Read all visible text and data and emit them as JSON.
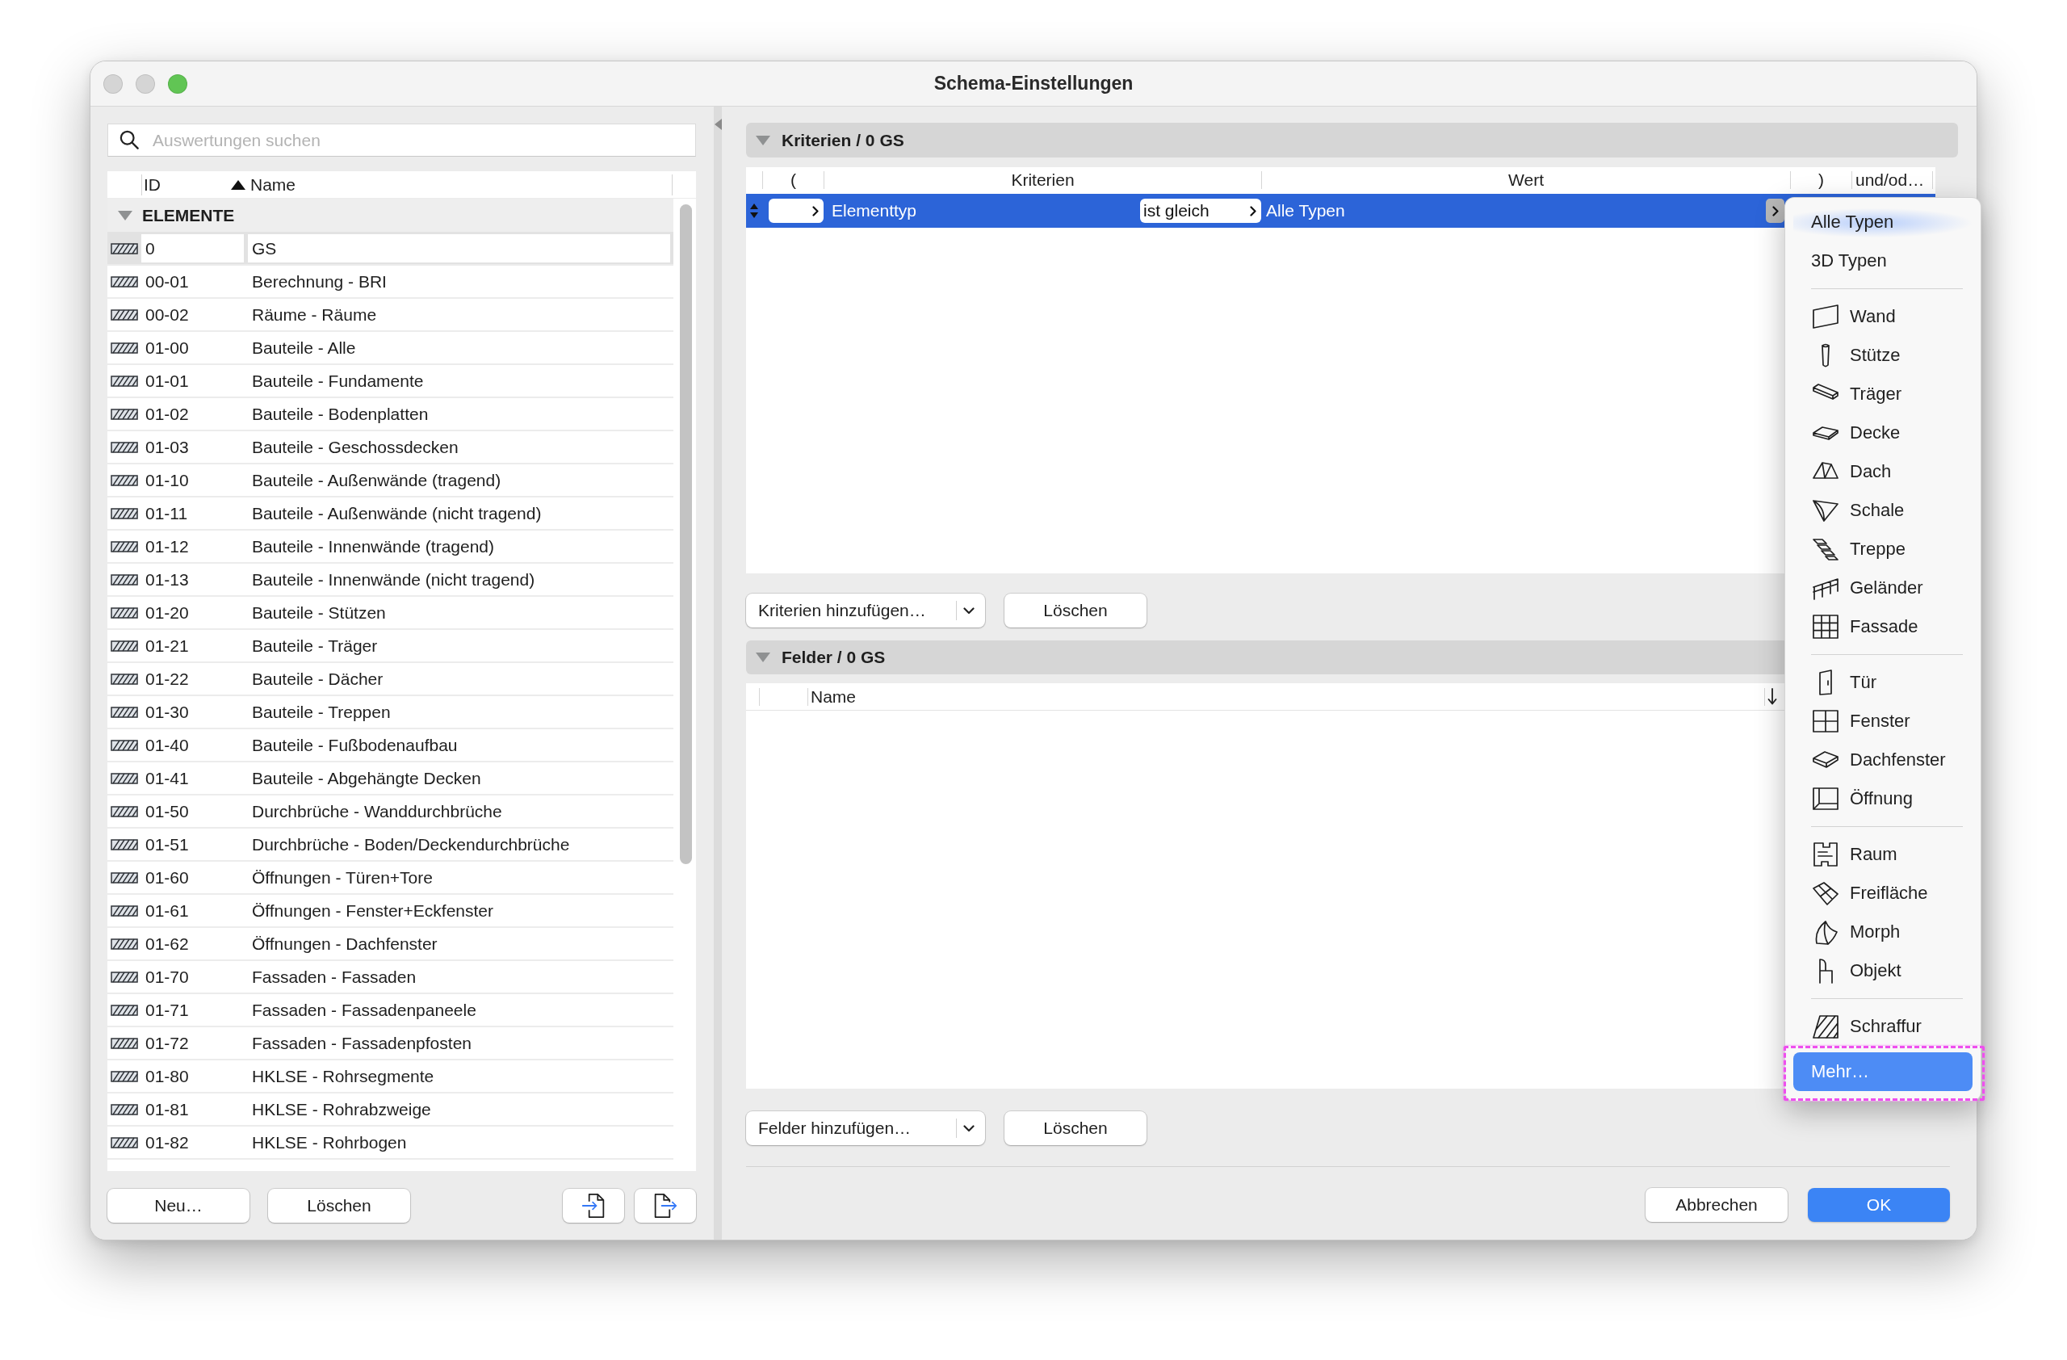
{
  "window": {
    "title": "Schema-Einstellungen",
    "controls": [
      {
        "kind": "close",
        "disabled": true
      },
      {
        "kind": "minimize",
        "disabled": true
      },
      {
        "kind": "zoom",
        "disabled": false
      }
    ]
  },
  "sidebar": {
    "search": {
      "placeholder": "Auswertungen suchen"
    },
    "columns": [
      {
        "label": "ID",
        "sorted": true
      },
      {
        "label": "Name",
        "sorted": false
      }
    ],
    "group": {
      "label": "ELEMENTE",
      "expanded": true
    },
    "rows": [
      {
        "id": "0",
        "name": "GS",
        "selected": true
      },
      {
        "id": "00-01",
        "name": "Berechnung - BRI",
        "selected": false
      },
      {
        "id": "00-02",
        "name": "Räume - Räume",
        "selected": false
      },
      {
        "id": "01-00",
        "name": "Bauteile - Alle",
        "selected": false
      },
      {
        "id": "01-01",
        "name": "Bauteile - Fundamente",
        "selected": false
      },
      {
        "id": "01-02",
        "name": "Bauteile - Bodenplatten",
        "selected": false
      },
      {
        "id": "01-03",
        "name": "Bauteile - Geschossdecken",
        "selected": false
      },
      {
        "id": "01-10",
        "name": "Bauteile - Außenwände (tragend)",
        "selected": false
      },
      {
        "id": "01-11",
        "name": "Bauteile - Außenwände (nicht tragend)",
        "selected": false
      },
      {
        "id": "01-12",
        "name": "Bauteile - Innenwände (tragend)",
        "selected": false
      },
      {
        "id": "01-13",
        "name": "Bauteile - Innenwände (nicht tragend)",
        "selected": false
      },
      {
        "id": "01-20",
        "name": "Bauteile - Stützen",
        "selected": false
      },
      {
        "id": "01-21",
        "name": "Bauteile - Träger",
        "selected": false
      },
      {
        "id": "01-22",
        "name": "Bauteile - Dächer",
        "selected": false
      },
      {
        "id": "01-30",
        "name": "Bauteile - Treppen",
        "selected": false
      },
      {
        "id": "01-40",
        "name": "Bauteile - Fußbodenaufbau",
        "selected": false
      },
      {
        "id": "01-41",
        "name": "Bauteile - Abgehängte Decken",
        "selected": false
      },
      {
        "id": "01-50",
        "name": "Durchbrüche - Wanddurchbrüche",
        "selected": false
      },
      {
        "id": "01-51",
        "name": "Durchbrüche - Boden/Deckendurchbrüche",
        "selected": false
      },
      {
        "id": "01-60",
        "name": "Öffnungen - Türen+Tore",
        "selected": false
      },
      {
        "id": "01-61",
        "name": "Öffnungen - Fenster+Eckfenster",
        "selected": false
      },
      {
        "id": "01-62",
        "name": "Öffnungen - Dachfenster",
        "selected": false
      },
      {
        "id": "01-70",
        "name": "Fassaden - Fassaden",
        "selected": false
      },
      {
        "id": "01-71",
        "name": "Fassaden - Fassadenpaneele",
        "selected": false
      },
      {
        "id": "01-72",
        "name": "Fassaden - Fassadenpfosten",
        "selected": false
      },
      {
        "id": "01-80",
        "name": "HKLSE - Rohrsegmente",
        "selected": false
      },
      {
        "id": "01-81",
        "name": "HKLSE - Rohrabzweige",
        "selected": false
      },
      {
        "id": "01-82",
        "name": "HKLSE - Rohrbogen",
        "selected": false
      }
    ],
    "buttons": [
      {
        "label": "Neu…"
      },
      {
        "label": "Löschen"
      }
    ]
  },
  "criteria": {
    "title": "Kriterien / 0 GS",
    "expanded": true,
    "columns": [
      "(",
      "Kriterien",
      "Wert",
      ")",
      "und/od…"
    ],
    "rows": [
      {
        "criterion": "Elementtyp",
        "operator": "ist gleich",
        "value": "Alle Typen",
        "selected": true
      }
    ],
    "add_button": "Kriterien hinzufügen…",
    "delete_button": "Löschen"
  },
  "fields": {
    "title": "Felder / 0 GS",
    "expanded": true,
    "columns": [
      "Name"
    ],
    "add_button": "Felder hinzufügen…",
    "delete_button": "Löschen"
  },
  "dialog_buttons": [
    {
      "label": "Abbrechen",
      "kind": "secondary"
    },
    {
      "label": "OK",
      "kind": "default"
    }
  ],
  "type_menu": {
    "sections": [
      {
        "items": [
          {
            "label": "Alle Typen",
            "kind": "plain",
            "selected": false,
            "current": true,
            "outlined": false
          },
          {
            "label": "3D Typen",
            "kind": "plain",
            "selected": false,
            "current": false,
            "outlined": false
          }
        ]
      },
      {
        "items": [
          {
            "label": "Wand",
            "kind": "icon",
            "selected": false,
            "current": false,
            "outlined": false
          },
          {
            "label": "Stütze",
            "kind": "icon",
            "selected": false,
            "current": false,
            "outlined": false
          },
          {
            "label": "Träger",
            "kind": "icon",
            "selected": false,
            "current": false,
            "outlined": false
          },
          {
            "label": "Decke",
            "kind": "icon",
            "selected": false,
            "current": false,
            "outlined": false
          },
          {
            "label": "Dach",
            "kind": "icon",
            "selected": false,
            "current": false,
            "outlined": false
          },
          {
            "label": "Schale",
            "kind": "icon",
            "selected": false,
            "current": false,
            "outlined": false
          },
          {
            "label": "Treppe",
            "kind": "icon",
            "selected": false,
            "current": false,
            "outlined": false
          },
          {
            "label": "Geländer",
            "kind": "icon",
            "selected": false,
            "current": false,
            "outlined": false
          },
          {
            "label": "Fassade",
            "kind": "icon",
            "selected": false,
            "current": false,
            "outlined": false
          }
        ]
      },
      {
        "items": [
          {
            "label": "Tür",
            "kind": "icon",
            "selected": false,
            "current": false,
            "outlined": false
          },
          {
            "label": "Fenster",
            "kind": "icon",
            "selected": false,
            "current": false,
            "outlined": false
          },
          {
            "label": "Dachfenster",
            "kind": "icon",
            "selected": false,
            "current": false,
            "outlined": false
          },
          {
            "label": "Öffnung",
            "kind": "icon",
            "selected": false,
            "current": false,
            "outlined": false
          }
        ]
      },
      {
        "items": [
          {
            "label": "Raum",
            "kind": "icon",
            "selected": false,
            "current": false,
            "outlined": false
          },
          {
            "label": "Freifläche",
            "kind": "icon",
            "selected": false,
            "current": false,
            "outlined": false
          },
          {
            "label": "Morph",
            "kind": "icon",
            "selected": false,
            "current": false,
            "outlined": false
          },
          {
            "label": "Objekt",
            "kind": "icon",
            "selected": false,
            "current": false,
            "outlined": false
          }
        ]
      },
      {
        "items": [
          {
            "label": "Schraffur",
            "kind": "icon",
            "selected": false,
            "current": false,
            "outlined": false
          },
          {
            "label": "Mehr…",
            "kind": "plain",
            "selected": true,
            "current": false,
            "outlined": true
          }
        ]
      }
    ]
  }
}
